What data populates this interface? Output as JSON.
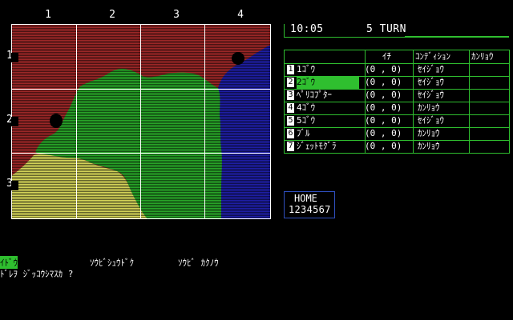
{
  "map": {
    "columns": [
      "1",
      "2",
      "3",
      "4"
    ],
    "rows": [
      "1",
      "2",
      "3"
    ],
    "terrain_colors": {
      "red": "#a02828",
      "green": "#29a829",
      "blue": "#1f1fa8",
      "yellow": "#d8d85a",
      "grid": "#ffffff"
    }
  },
  "status": {
    "time": "10:05",
    "turn": "5 TURN"
  },
  "unit_table": {
    "headers": [
      "",
      "ｲﾁ",
      "ｺﾝﾃﾞｨｼｮﾝ",
      "ｶﾝﾘｮｳ"
    ],
    "rows": [
      {
        "idx": "1",
        "name": "1ｺﾞｳ",
        "pos": "(0 , 0)",
        "cond": "ｾｲｼﾞｮｳ",
        "cap": "",
        "selected": false
      },
      {
        "idx": "2",
        "name": "2ｺﾞｳ",
        "pos": "(0 , 0)",
        "cond": "ｾｲｼﾞｮｳ",
        "cap": "",
        "selected": true
      },
      {
        "idx": "3",
        "name": "ﾍﾟﾘｺﾌﾟﾀｰ",
        "pos": "(0 , 0)",
        "cond": "ｾｲｼﾞｮｳ",
        "cap": "",
        "selected": false
      },
      {
        "idx": "4",
        "name": "4ｺﾞｳ",
        "pos": "(0 , 0)",
        "cond": "ｶﾝﾘｮｳ",
        "cap": "",
        "selected": false
      },
      {
        "idx": "5",
        "name": "5ｺﾞｳ",
        "pos": "(0 , 0)",
        "cond": "ｾｲｼﾞｮｳ",
        "cap": "",
        "selected": false
      },
      {
        "idx": "6",
        "name": "ﾌﾞﾙ",
        "pos": "(0 , 0)",
        "cond": "ｶﾝﾘｮｳ",
        "cap": "",
        "selected": false
      },
      {
        "idx": "7",
        "name": "ｼﾞｪｯﾄﾓｸﾞﾗ",
        "pos": "(0 , 0)",
        "cond": "ｶﾝﾘｮｳ",
        "cap": "",
        "selected": false
      }
    ]
  },
  "home": {
    "label": "HOME",
    "slots": "1234567"
  },
  "menu": {
    "options": [
      "ｲﾄﾞｳ",
      "ｿｳﾋﾞｼｭｳﾄﾞｸ",
      "ｿｳﾋﾞ ｶｸﾉｳ"
    ],
    "selected": 0
  },
  "prompt": "ﾄﾞﾚｦ ｼﾞｯｺｳｼﾏｽｶ ?",
  "colors": {
    "panel_border": "#2fbf2f",
    "home_border": "#2f4fbf",
    "highlight": "#2fbf2f"
  }
}
